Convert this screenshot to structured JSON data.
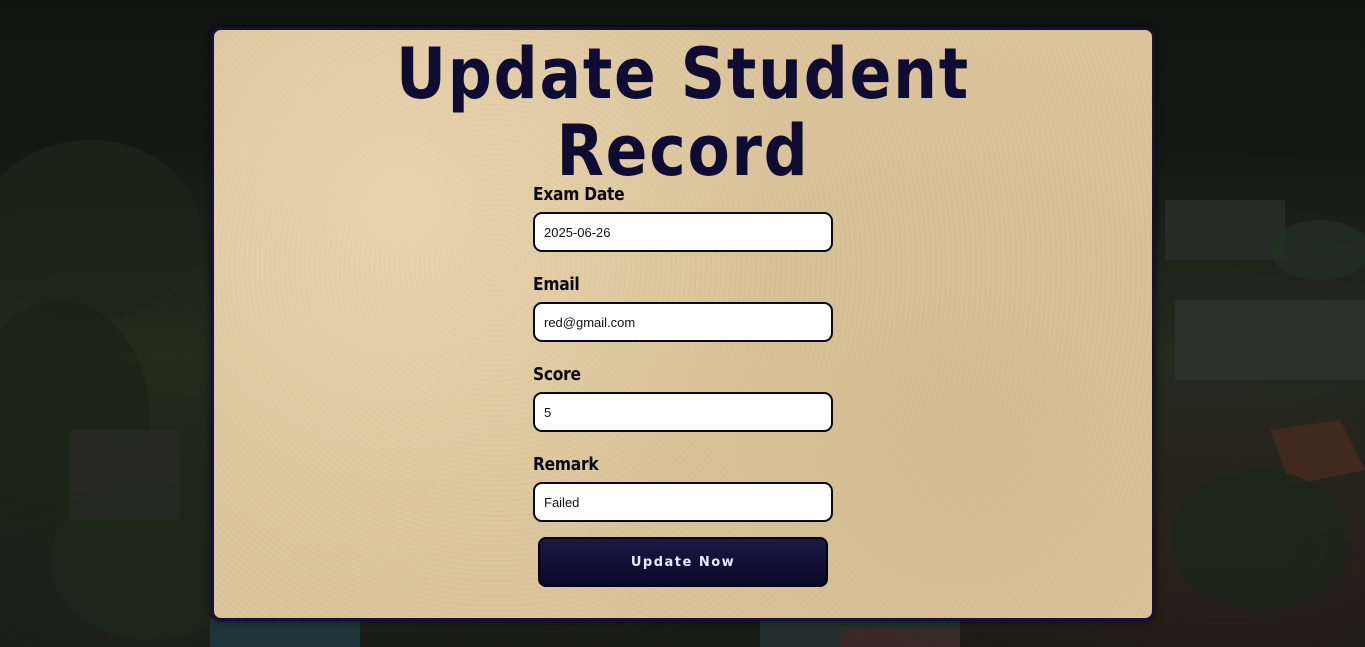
{
  "page": {
    "title": "Update Student Record"
  },
  "form": {
    "fields": [
      {
        "label": "Exam Date",
        "value": "2025-06-26"
      },
      {
        "label": "Email",
        "value": "red@gmail.com"
      },
      {
        "label": "Score",
        "value": "5"
      },
      {
        "label": "Remark",
        "value": "Failed"
      }
    ],
    "submit_label": "Update Now"
  },
  "colors": {
    "accent": "#14123a",
    "card_background": "#dcc59c",
    "button_background": "#0a0826",
    "button_text": "#e9e6ff"
  }
}
